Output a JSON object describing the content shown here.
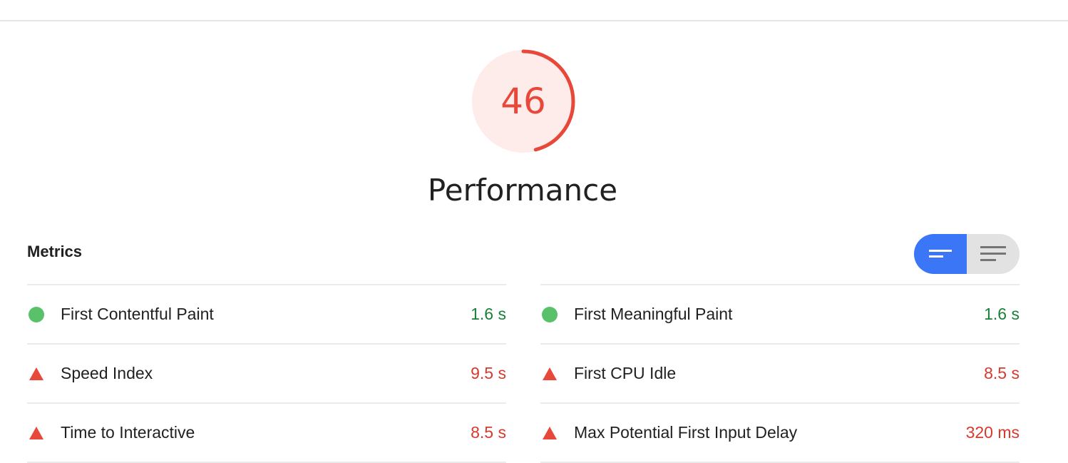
{
  "score": {
    "value": "46",
    "fraction": 0.46,
    "label": "Performance",
    "color": "#e8483a",
    "track_color": "#fdecea"
  },
  "metrics": {
    "title": "Metrics",
    "toggle": {
      "options": [
        "bars-icon",
        "lines-icon"
      ],
      "selected": "bars-icon"
    },
    "left": [
      {
        "name": "First Contentful Paint",
        "value": "1.6 s",
        "status": "good"
      },
      {
        "name": "Speed Index",
        "value": "9.5 s",
        "status": "bad"
      },
      {
        "name": "Time to Interactive",
        "value": "8.5 s",
        "status": "bad"
      }
    ],
    "right": [
      {
        "name": "First Meaningful Paint",
        "value": "1.6 s",
        "status": "good"
      },
      {
        "name": "First CPU Idle",
        "value": "8.5 s",
        "status": "bad"
      },
      {
        "name": "Max Potential First Input Delay",
        "value": "320 ms",
        "status": "bad"
      }
    ]
  },
  "colors": {
    "good": "#188039",
    "good_dot": "#5ac16b",
    "bad": "#d8392e",
    "bad_icon": "#e8483a",
    "accent": "#3b76f6"
  }
}
